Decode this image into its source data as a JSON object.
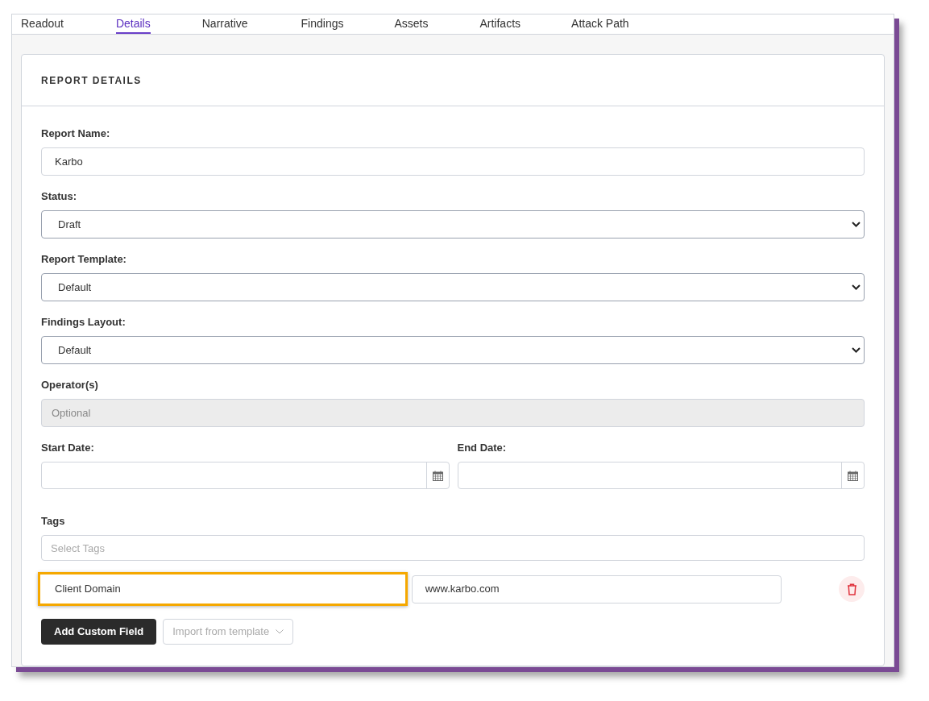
{
  "tabs": [
    {
      "label": "Readout",
      "selected": false
    },
    {
      "label": "Details",
      "selected": true
    },
    {
      "label": "Narrative",
      "selected": false
    },
    {
      "label": "Findings",
      "selected": false
    },
    {
      "label": "Assets",
      "selected": false
    },
    {
      "label": "Artifacts",
      "selected": false
    },
    {
      "label": "Attack Path",
      "selected": false
    }
  ],
  "card_title": "REPORT DETAILS",
  "fields": [
    {
      "label": "Report Name:",
      "kind": "text",
      "value": "Karbo"
    },
    {
      "label": "Status:",
      "kind": "select",
      "value": "Draft"
    },
    {
      "label": "Report Template:",
      "kind": "select",
      "value": "Default"
    },
    {
      "label": "Findings Layout:",
      "kind": "select",
      "value": "Default"
    },
    {
      "label": "Operator(s)",
      "kind": "disabled",
      "placeholder": "Optional"
    }
  ],
  "dates": [
    {
      "label": "Start Date:"
    },
    {
      "label": "End Date:"
    }
  ],
  "tags": {
    "label": "Tags",
    "placeholder": "Select Tags"
  },
  "custom_field": {
    "name": "Client Domain",
    "value": "www.karbo.com",
    "highlighted": true
  },
  "buttons": {
    "add": "Add Custom Field",
    "import": "Import from template"
  }
}
